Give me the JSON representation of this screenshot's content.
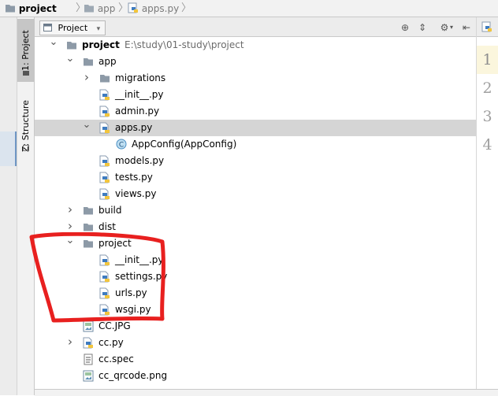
{
  "breadcrumb": [
    {
      "label": "project",
      "icon": "folder-icon",
      "active": true
    },
    {
      "label": "app",
      "icon": "folder-icon",
      "active": false
    },
    {
      "label": "apps.py",
      "icon": "python-file-icon",
      "active": false
    }
  ],
  "toolwindows": {
    "project": "1: Project",
    "structure": "Z: Structure"
  },
  "panel": {
    "view_selector": "Project"
  },
  "tree": [
    {
      "depth": 0,
      "arrow": "down",
      "icon": "folder",
      "label": "project",
      "bold": true,
      "suffix": "E:\\study\\01-study\\project"
    },
    {
      "depth": 1,
      "arrow": "down",
      "icon": "folder",
      "label": "app"
    },
    {
      "depth": 2,
      "arrow": "right",
      "icon": "folder",
      "label": "migrations"
    },
    {
      "depth": 2,
      "arrow": "",
      "icon": "python",
      "label": "__init__.py"
    },
    {
      "depth": 2,
      "arrow": "",
      "icon": "python",
      "label": "admin.py"
    },
    {
      "depth": 2,
      "arrow": "down",
      "icon": "python",
      "label": "apps.py",
      "selected": true
    },
    {
      "depth": 3,
      "arrow": "",
      "icon": "class",
      "label": "AppConfig(AppConfig)"
    },
    {
      "depth": 2,
      "arrow": "",
      "icon": "python",
      "label": "models.py"
    },
    {
      "depth": 2,
      "arrow": "",
      "icon": "python",
      "label": "tests.py"
    },
    {
      "depth": 2,
      "arrow": "",
      "icon": "python",
      "label": "views.py"
    },
    {
      "depth": 1,
      "arrow": "right",
      "icon": "folder",
      "label": "build"
    },
    {
      "depth": 1,
      "arrow": "right",
      "icon": "folder",
      "label": "dist"
    },
    {
      "depth": 1,
      "arrow": "down",
      "icon": "folder",
      "label": "project"
    },
    {
      "depth": 2,
      "arrow": "",
      "icon": "python",
      "label": "__init__.py"
    },
    {
      "depth": 2,
      "arrow": "",
      "icon": "python",
      "label": "settings.py"
    },
    {
      "depth": 2,
      "arrow": "",
      "icon": "python",
      "label": "urls.py"
    },
    {
      "depth": 2,
      "arrow": "",
      "icon": "python",
      "label": "wsgi.py"
    },
    {
      "depth": 1,
      "arrow": "",
      "icon": "image",
      "label": "CC.JPG"
    },
    {
      "depth": 1,
      "arrow": "right",
      "icon": "python",
      "label": "cc.py"
    },
    {
      "depth": 1,
      "arrow": "",
      "icon": "text",
      "label": "cc.spec"
    },
    {
      "depth": 1,
      "arrow": "",
      "icon": "image",
      "label": "cc_qrcode.png"
    }
  ],
  "editor": {
    "line_numbers": [
      "1",
      "2",
      "3",
      "4"
    ]
  },
  "colors": {
    "annotation": "#e8201f",
    "selection": "#d5d5d5",
    "python_blue": "#3f7cc0",
    "python_yellow": "#f2c53d",
    "folder": "#8d9aa7"
  }
}
